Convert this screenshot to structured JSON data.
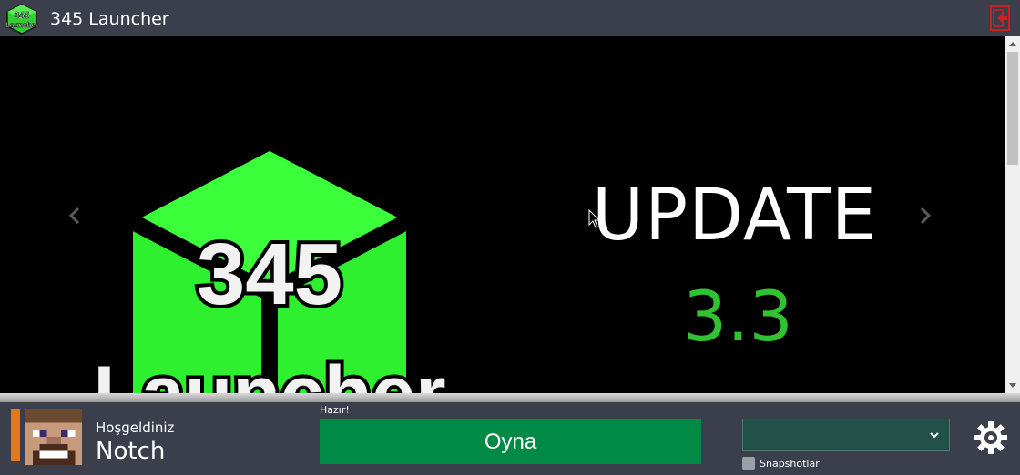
{
  "window": {
    "title": "345 Launcher"
  },
  "icons": {
    "app": "345-launcher-logo-icon",
    "exit": "exit-icon",
    "prev": "chevron-left-icon",
    "next": "chevron-right-icon",
    "settings": "gear-icon",
    "dropdown": "chevron-down-icon"
  },
  "banner": {
    "logo_number": "345",
    "logo_word": "Launcher",
    "headline": "UPDATE",
    "version": "3.3"
  },
  "app_icon_text": {
    "line1": "345",
    "line2": "Launcher"
  },
  "user": {
    "greeting": "Hoşgeldiniz",
    "name": "Notch"
  },
  "play": {
    "status": "Hazır!",
    "button_label": "Oyna"
  },
  "version_select": {
    "selected": ""
  },
  "snapshots": {
    "label": "Snapshotlar",
    "checked": false
  },
  "colors": {
    "accent": "#e07820",
    "play": "#008a46",
    "brand_green": "#2fc42f",
    "background": "#3a3f4b"
  }
}
